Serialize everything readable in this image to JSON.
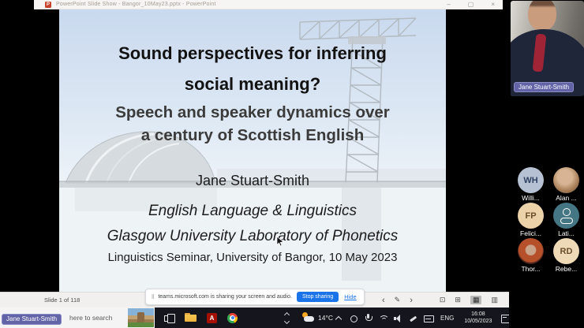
{
  "window": {
    "title": "PowerPoint Slide Show - Bangor_10May23.pptx - PowerPoint",
    "controls": {
      "minimize": "–",
      "maximize": "▢",
      "close": "×"
    }
  },
  "slide": {
    "title": [
      "Sound perspectives for inferring",
      "social meaning?"
    ],
    "subtitle": [
      "Speech and speaker dynamics over",
      "a century of Scottish English"
    ],
    "author": "Jane Stuart-Smith",
    "affiliation": [
      "English Language & Linguistics",
      "Glasgow University Laboratory of Phonetics"
    ],
    "venue": "Linguistics Seminar, University of Bangor, 10 May 2023"
  },
  "slideshow_bar": {
    "counter": "Slide 1 of 118",
    "prev": "‹",
    "pen": "✎",
    "next": "›",
    "views": [
      "⊡",
      "⊞",
      "▦",
      "▥"
    ]
  },
  "share_banner": {
    "grip": "‖",
    "message": "teams.microsoft.com is sharing your screen and audio.",
    "stop_button": "Stop sharing",
    "hide_link": "Hide"
  },
  "taskbar": {
    "search_text": "here to search",
    "presenter_tag": "Jane Stuart-Smith",
    "weather_temp": "14°C",
    "lang": "ENG",
    "time": "16:08",
    "date": "10/05/2023"
  },
  "icons": {
    "ppt_glyph": "P",
    "adobe_glyph": "A"
  },
  "sidebar": {
    "video_name": "Jane Stuart-Smith",
    "participants": [
      {
        "avatar": "initials",
        "initials": "WH",
        "label": "Willi...",
        "avatar_bg": "#b6c2d4"
      },
      {
        "avatar": "photo",
        "label": "Alan ..."
      },
      {
        "avatar": "initials",
        "initials": "FP",
        "label": "Felici...",
        "avatar_bg": "#ecd2a9"
      },
      {
        "avatar": "person-icon",
        "label": "Lati...",
        "avatar_bg": "#457684"
      },
      {
        "avatar": "photo",
        "label": "Thor..."
      },
      {
        "avatar": "initials",
        "initials": "RD",
        "label": "Rebe...",
        "avatar_bg": "#eedab6"
      }
    ]
  },
  "colors": {
    "teams_purple": "#6264a7",
    "stop_sharing_blue": "#1a73e8",
    "powerpoint_red": "#c8432c",
    "taskbar_bg": "#15161d",
    "scarf_red": "#9e2436"
  }
}
